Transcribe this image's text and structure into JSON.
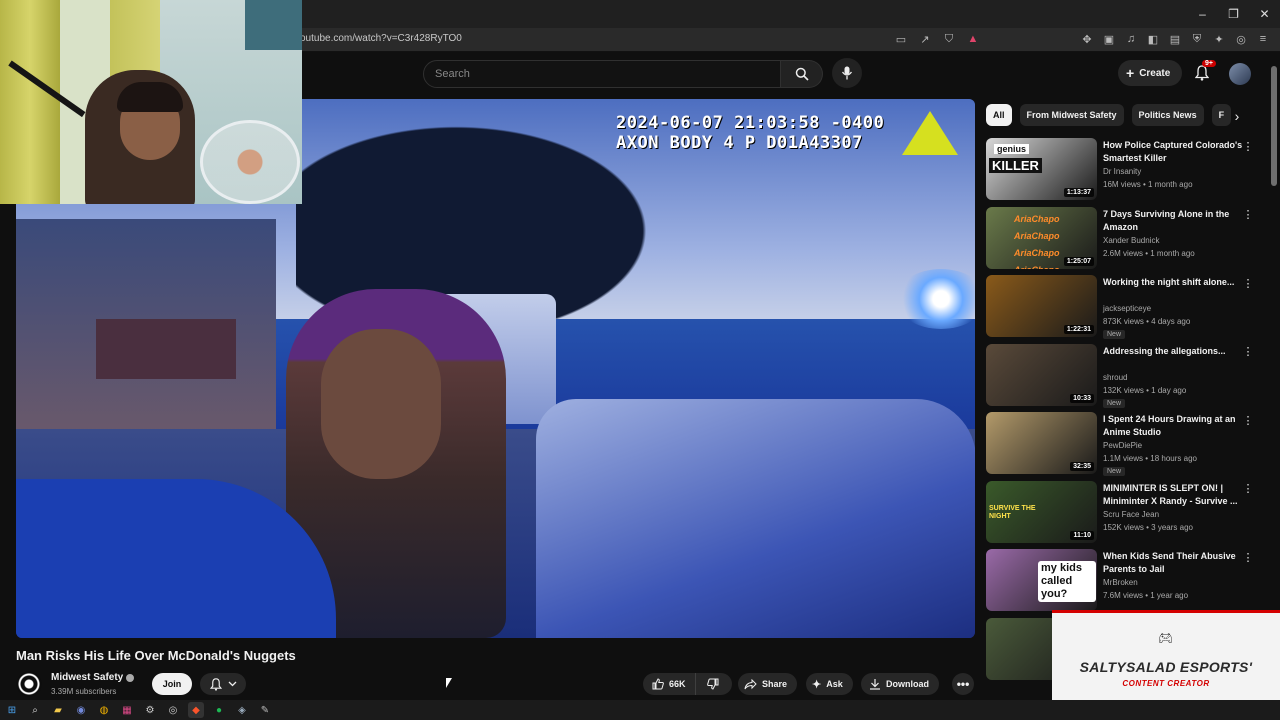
{
  "browser": {
    "url": "outube.com/watch?v=C3r428RyTO0",
    "window_controls": [
      "–",
      "❐",
      "✕"
    ]
  },
  "header": {
    "search_placeholder": "Search",
    "create_label": "Create",
    "notif_badge": "9+"
  },
  "video": {
    "osd_line1": "2024-06-07 21:03:58 -0400",
    "osd_line2": "AXON BODY 4 P D01A43307",
    "title": "Man Risks His Life Over McDonald's Nuggets"
  },
  "channel": {
    "name": "Midwest Safety",
    "subscribers": "3.39M subscribers",
    "join_label": "Join"
  },
  "actions": {
    "likes": "66K",
    "share_label": "Share",
    "ask_label": "Ask",
    "download_label": "Download"
  },
  "chips": [
    "All",
    "From Midwest Safety",
    "Politics News",
    "F"
  ],
  "recommendations": [
    {
      "title": "How Police Captured Colorado's Smartest Killer",
      "channel": "Dr Insanity",
      "meta": "16M views • 1 month ago",
      "duration": "1:13:37",
      "badge": "",
      "thumb_color": "#d8d8d8"
    },
    {
      "title": "7 Days Surviving Alone in the Amazon",
      "channel": "Xander Budnick",
      "meta": "2.6M views • 1 month ago",
      "duration": "1:25:07",
      "badge": "",
      "thumb_color": "#6a7a4a"
    },
    {
      "title": "Working the night shift alone...",
      "channel": "jacksepticeye",
      "meta": "873K views • 4 days ago",
      "duration": "1:22:31",
      "badge": "New",
      "thumb_color": "#8a5a1a"
    },
    {
      "title": "Addressing the allegations...",
      "channel": "shroud",
      "meta": "132K views • 1 day ago",
      "duration": "10:33",
      "badge": "New",
      "thumb_color": "#5a4a3a"
    },
    {
      "title": "I Spent 24 Hours Drawing at an Anime Studio",
      "channel": "PewDiePie",
      "meta": "1.1M views • 18 hours ago",
      "duration": "32:35",
      "badge": "New",
      "thumb_color": "#b39a6a"
    },
    {
      "title": "MINIMINTER IS SLEPT ON! | Miniminter X Randy - Survive ...",
      "channel": "Scru Face Jean",
      "meta": "152K views • 3 years ago",
      "duration": "11:10",
      "badge": "",
      "thumb_color": "#3a5a2a"
    },
    {
      "title": "When Kids Send Their Abusive Parents to Jail",
      "channel": "MrBroken",
      "meta": "7.6M views • 1 year ago",
      "duration": "",
      "badge": "",
      "thumb_color": "#9a6aa8"
    },
    {
      "title": "",
      "channel": "",
      "meta": "",
      "duration": "",
      "badge": "",
      "thumb_color": "#4a5a3a"
    }
  ],
  "thumb_texts": {
    "rec0": "KILLER",
    "rec0_small": "genius",
    "rec5": "SURVIVE THE NIGHT",
    "rec6": "my kids called you?"
  },
  "overlay_tag": "AriaChapo",
  "branding": {
    "name": "SALTYSALAD ESPORTS'",
    "role": "CONTENT CREATOR"
  }
}
